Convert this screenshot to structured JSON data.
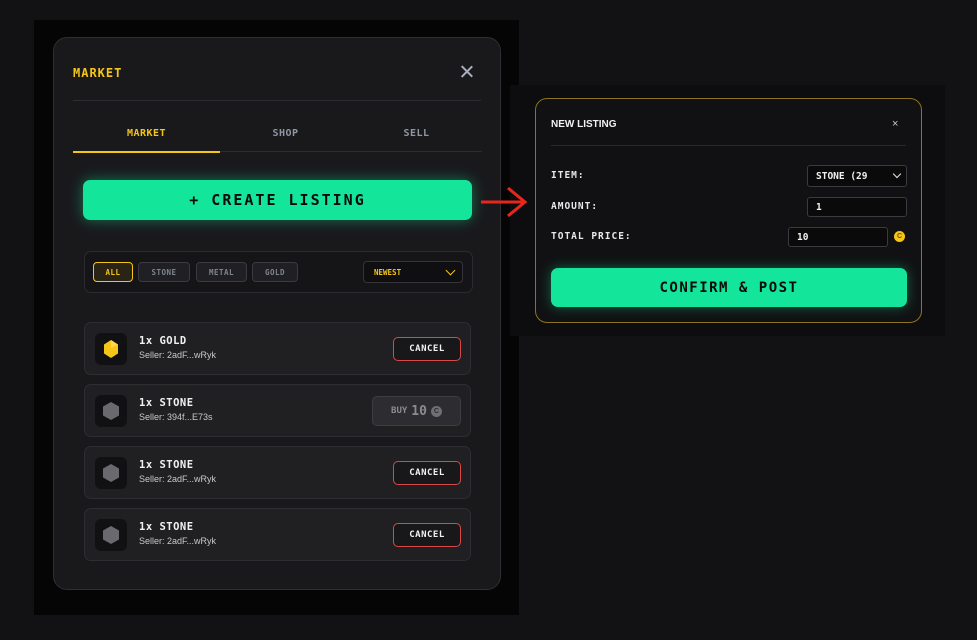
{
  "market": {
    "title": "MARKET",
    "tabs": [
      {
        "label": "MARKET",
        "active": true
      },
      {
        "label": "SHOP",
        "active": false
      },
      {
        "label": "SELL",
        "active": false
      }
    ],
    "create_button": "+ CREATE LISTING",
    "filters": [
      {
        "label": "ALL",
        "active": true
      },
      {
        "label": "STONE",
        "active": false
      },
      {
        "label": "METAL",
        "active": false
      },
      {
        "label": "GOLD",
        "active": false
      }
    ],
    "sort": "NEWEST",
    "listings": [
      {
        "name": "1x GOLD",
        "seller": "Seller: 2adF...wRyk",
        "icon": "gold-icon",
        "action": "CANCEL"
      },
      {
        "name": "1x STONE",
        "seller": "Seller: 394f...E73s",
        "icon": "stone-icon",
        "action": "BUY",
        "price": "10",
        "coin": "C"
      },
      {
        "name": "1x STONE",
        "seller": "Seller: 2adF...wRyk",
        "icon": "stone-icon",
        "action": "CANCEL"
      },
      {
        "name": "1x STONE",
        "seller": "Seller: 2adF...wRyk",
        "icon": "stone-icon",
        "action": "CANCEL"
      }
    ]
  },
  "new_listing": {
    "title": "NEW LISTING",
    "close": "×",
    "item_label": "ITEM:",
    "item_value": "STONE (29",
    "amount_label": "AMOUNT:",
    "amount_value": "1",
    "price_label": "TOTAL PRICE:",
    "price_value": "10",
    "coin": "C",
    "confirm_button": "CONFIRM & POST"
  },
  "colors": {
    "accent_gold": "#f5c518",
    "accent_green": "#13e69a",
    "danger_red": "#d94848",
    "arrow_red": "#e8261c"
  }
}
